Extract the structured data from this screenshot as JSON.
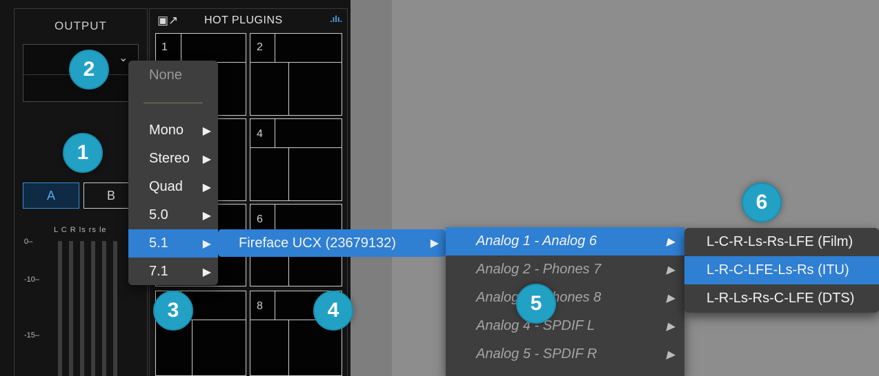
{
  "output": {
    "title": "OUTPUT",
    "ab_buttons": [
      "A",
      "B"
    ],
    "channel_labels": "L  C  R  ls  rs  le",
    "scale": [
      "0–",
      "-10–",
      "-15–"
    ]
  },
  "hot_plugins": {
    "title": "HOT PLUGINS",
    "left_icon": "export-icon",
    "right_icon": "bars-icon",
    "slots": [
      "1",
      "2",
      "4",
      "6",
      "8"
    ]
  },
  "menu_format": {
    "none_label": "None",
    "items": [
      "Mono",
      "Stereo",
      "Quad",
      "5.0",
      "5.1",
      "7.1"
    ],
    "selected": "5.1"
  },
  "menu_device": {
    "label": "Fireface UCX (23679132)"
  },
  "menu_channels": {
    "items": [
      "Analog 1 - Analog 6",
      "Analog 2 - Phones 7",
      "Analog 3 - Phones 8",
      "Analog 4 - SPDIF L",
      "Analog 5 - SPDIF R"
    ],
    "selected": "Analog 1 - Analog 6"
  },
  "menu_layout": {
    "items": [
      "L-C-R-Ls-Rs-LFE (Film)",
      "L-R-C-LFE-Ls-Rs (ITU)",
      "L-R-Ls-Rs-C-LFE (DTS)"
    ],
    "selected": "L-R-C-LFE-Ls-Rs (ITU)"
  },
  "callouts": [
    "1",
    "2",
    "3",
    "4",
    "5",
    "6"
  ],
  "colors": {
    "accent": "#2f7fd3",
    "badge": "#23a1c4",
    "panel": "#141414",
    "background": "#8d8d8d"
  }
}
